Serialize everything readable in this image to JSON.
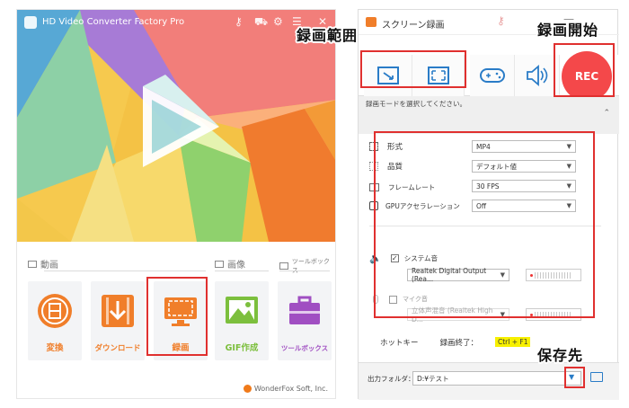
{
  "left_window": {
    "title": "HD Video Converter Factory Pro",
    "sections": {
      "video": "動画",
      "image": "画像",
      "toolbox": "ツールボックス"
    },
    "tiles": [
      {
        "label": "変換",
        "color": "#f07e2a",
        "icon": "film-icon"
      },
      {
        "label": "ダウンロード",
        "color": "#f07e2a",
        "icon": "download-icon"
      },
      {
        "label": "録画",
        "color": "#f07e2a",
        "icon": "screen-record-icon"
      },
      {
        "label": "GIF作成",
        "color": "#7cbf3d",
        "icon": "image-icon"
      },
      {
        "label": "ツールボックス",
        "color": "#a04fc2",
        "icon": "toolbox-icon"
      }
    ],
    "footer": "WonderFox Soft, Inc."
  },
  "right_window": {
    "title": "スクリーン録画",
    "rec_label": "REC",
    "mode_hint": "録画モードを選択してください。",
    "settings": {
      "format_label": "形式",
      "format_value": "MP4",
      "quality_label": "品質",
      "quality_value": "デフォルト値",
      "framerate_label": "フレームレート",
      "framerate_value": "30 FPS",
      "gpu_label": "GPUアクセラレーション",
      "gpu_value": "Off",
      "system_audio_label": "システム音",
      "system_audio_device": "Realtek Digital Output (Rea...",
      "mic_label": "マイク音",
      "mic_device": "立体声混音 (Realtek High D..."
    },
    "hotkey_label": "ホットキー",
    "hotkey_action": "録画終了：",
    "hotkey_value": "Ctrl + F1",
    "output_label": "出力フォルダ：",
    "output_value": "D:¥テスト"
  },
  "annotations": {
    "record_range": "録画範囲",
    "record_start": "録画開始",
    "save_to": "保存先"
  },
  "colors": {
    "accent_red": "#e0302f",
    "rec_red": "#f4484a",
    "hotkey_yellow": "#f7f000"
  }
}
